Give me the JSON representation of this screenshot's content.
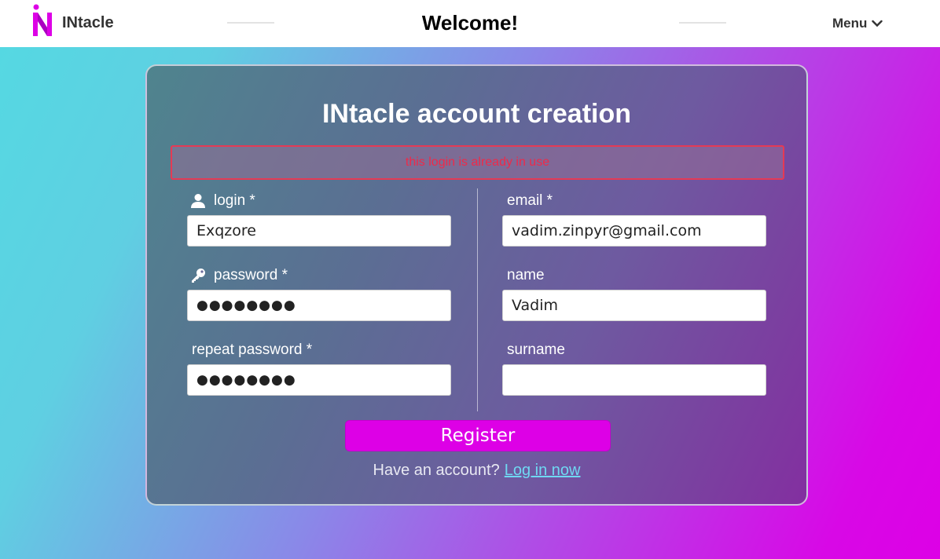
{
  "header": {
    "brand": "INtacle",
    "title": "Welcome!",
    "menu_label": "Menu"
  },
  "card": {
    "title": "INtacle account creation",
    "error": "this login is already in use",
    "fields": {
      "login": {
        "label": "login *",
        "value": "Exqzore"
      },
      "password": {
        "label": "password *",
        "value": "●●●●●●●●"
      },
      "repeat_password": {
        "label": "repeat password *",
        "value": "●●●●●●●●"
      },
      "email": {
        "label": "email *",
        "value": "vadim.zinpyr@gmail.com"
      },
      "name": {
        "label": "name",
        "value": "Vadim"
      },
      "surname": {
        "label": "surname",
        "value": ""
      }
    },
    "register_label": "Register",
    "have_account": "Have an account?",
    "login_link": "Log in now"
  },
  "colors": {
    "accent": "#dd00e6",
    "error": "#ee2a4a",
    "link": "#6fd8f2"
  },
  "icons": [
    "logo-icon",
    "chevron-down-icon",
    "user-icon",
    "key-icon"
  ]
}
